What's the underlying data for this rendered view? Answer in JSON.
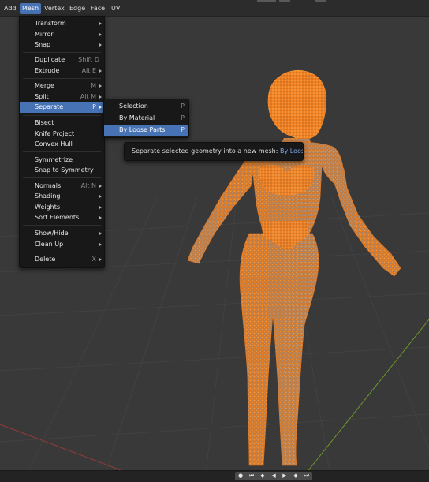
{
  "topbar": {
    "menus": [
      {
        "label": "Add",
        "active": false
      },
      {
        "label": "Mesh",
        "active": true
      },
      {
        "label": "Vertex",
        "active": false
      },
      {
        "label": "Edge",
        "active": false
      },
      {
        "label": "Face",
        "active": false
      },
      {
        "label": "UV",
        "active": false
      }
    ]
  },
  "mesh_menu": {
    "items": [
      {
        "label": "Transform",
        "shortcut": "",
        "submenu": true
      },
      {
        "label": "Mirror",
        "shortcut": "",
        "submenu": true
      },
      {
        "label": "Snap",
        "shortcut": "",
        "submenu": true
      },
      {
        "label": "Duplicate",
        "shortcut": "Shift D",
        "submenu": false
      },
      {
        "label": "Extrude",
        "shortcut": "Alt E",
        "submenu": true
      },
      {
        "label": "Merge",
        "shortcut": "M",
        "submenu": true
      },
      {
        "label": "Split",
        "shortcut": "Alt M",
        "submenu": true
      },
      {
        "label": "Separate",
        "shortcut": "P",
        "submenu": true,
        "highlighted": true
      },
      {
        "label": "Bisect",
        "shortcut": "",
        "submenu": false
      },
      {
        "label": "Knife Project",
        "shortcut": "",
        "submenu": false
      },
      {
        "label": "Convex Hull",
        "shortcut": "",
        "submenu": false
      },
      {
        "label": "Symmetrize",
        "shortcut": "",
        "submenu": false
      },
      {
        "label": "Snap to Symmetry",
        "shortcut": "",
        "submenu": false
      },
      {
        "label": "Normals",
        "shortcut": "Alt N",
        "submenu": true
      },
      {
        "label": "Shading",
        "shortcut": "",
        "submenu": true
      },
      {
        "label": "Weights",
        "shortcut": "",
        "submenu": true
      },
      {
        "label": "Sort Elements...",
        "shortcut": "",
        "submenu": true
      },
      {
        "label": "Show/Hide",
        "shortcut": "",
        "submenu": true
      },
      {
        "label": "Clean Up",
        "shortcut": "",
        "submenu": true
      },
      {
        "label": "Delete",
        "shortcut": "X",
        "submenu": true
      }
    ]
  },
  "separate_submenu": {
    "items": [
      {
        "label": "Selection",
        "shortcut": "P"
      },
      {
        "label": "By Material",
        "shortcut": "P"
      },
      {
        "label": "By Loose Parts",
        "shortcut": "P",
        "highlighted": true
      }
    ]
  },
  "tooltip": {
    "description": "Separate selected geometry into a new mesh:",
    "operator": "By Loose Parts"
  },
  "playback": {
    "buttons": [
      {
        "icon": "record-icon",
        "glyph": "●"
      },
      {
        "icon": "jump-start-icon",
        "glyph": "⏮"
      },
      {
        "icon": "prev-keyframe-icon",
        "glyph": "◆"
      },
      {
        "icon": "play-reverse-icon",
        "glyph": "◀"
      },
      {
        "icon": "play-icon",
        "glyph": "▶"
      },
      {
        "icon": "next-keyframe-icon",
        "glyph": "◆"
      },
      {
        "icon": "jump-end-icon",
        "glyph": "⏭"
      }
    ]
  },
  "colors": {
    "accent": "#4772b3",
    "mesh": "#f0821e",
    "menu_bg": "#181818",
    "viewport_bg": "#393939",
    "x_axis": "#9a3a3a",
    "y_axis": "#6e9a2a"
  }
}
